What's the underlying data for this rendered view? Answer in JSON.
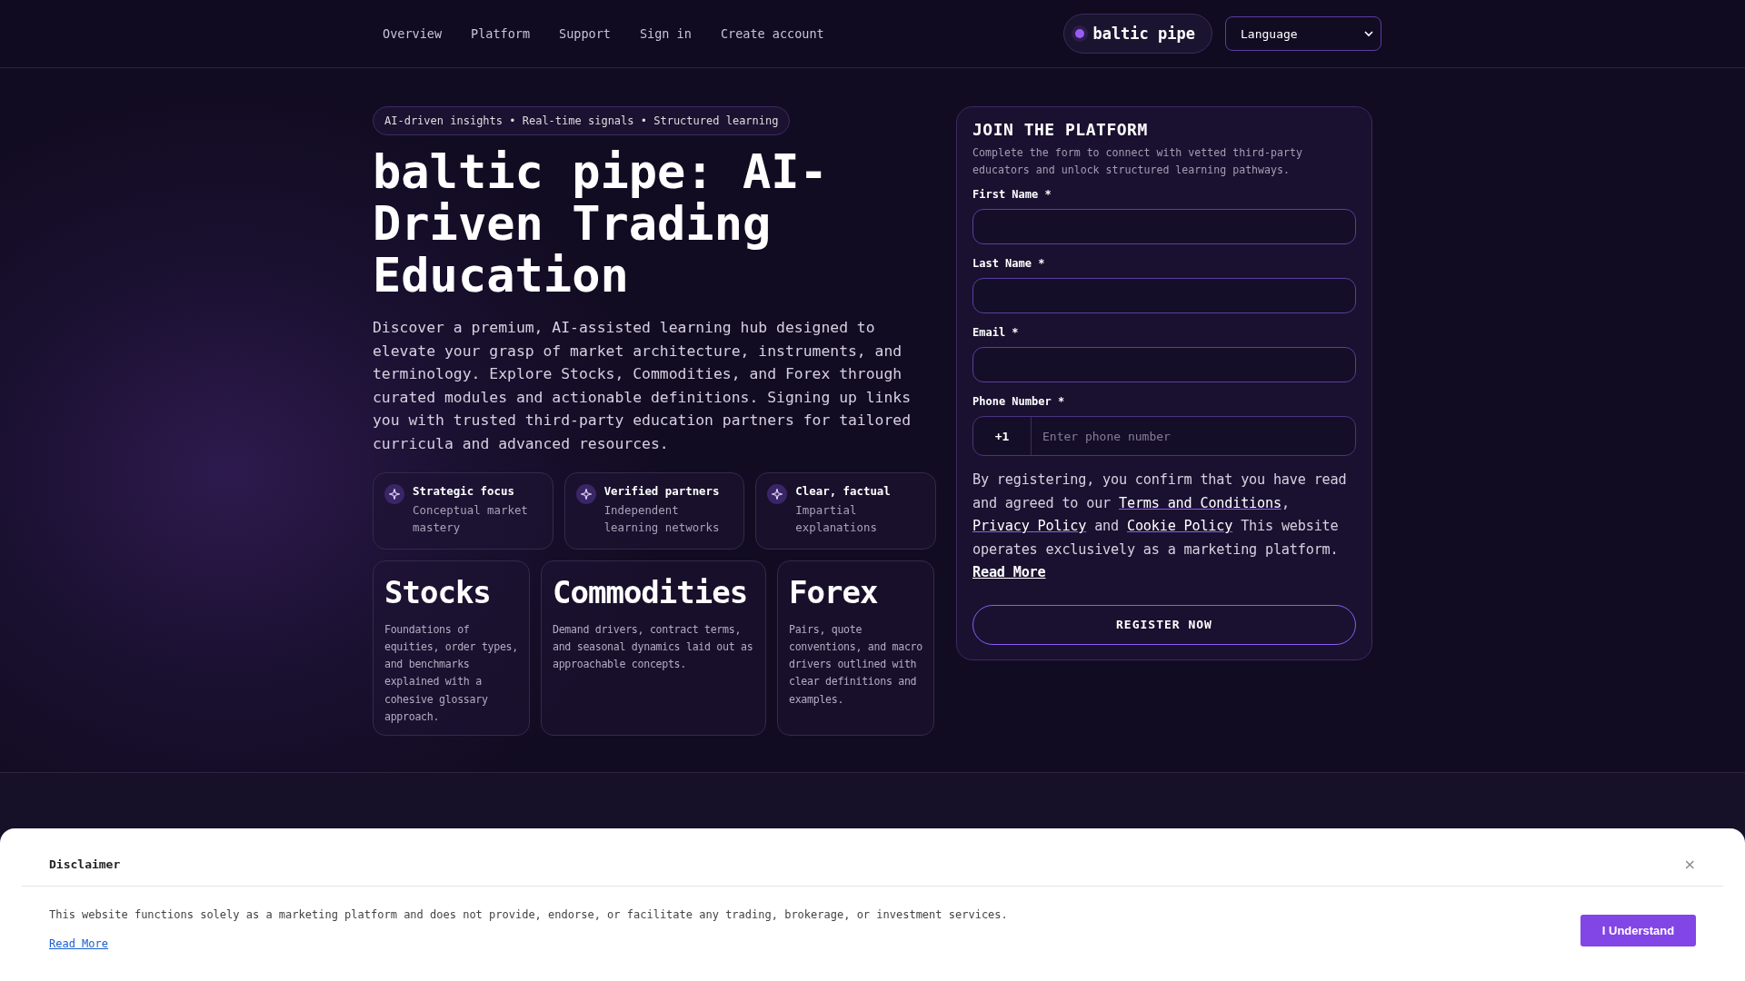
{
  "nav": {
    "links": [
      "Overview",
      "Platform",
      "Support",
      "Sign in",
      "Create account"
    ],
    "brand": "baltic pipe",
    "language": "Language"
  },
  "hero": {
    "tagline": "AI-driven insights • Real-time signals • Structured learning",
    "title": "baltic pipe: AI-Driven Trading Education",
    "description": "Discover a premium, AI-assisted learning hub designed to elevate your grasp of market architecture, instruments, and terminology. Explore Stocks, Commodities, and Forex through curated modules and actionable definitions. Signing up links you with trusted third-party education partners for tailored curricula and advanced resources.",
    "features": [
      {
        "title": "Strategic focus",
        "text": "Conceptual market mastery"
      },
      {
        "title": "Verified partners",
        "text": "Independent learning networks"
      },
      {
        "title": "Clear, factual",
        "text": "Impartial explanations"
      }
    ],
    "topics": [
      {
        "title": "Stocks",
        "text": "Foundations of equities, order types, and benchmarks explained with a cohesive glossary approach."
      },
      {
        "title": "Commodities",
        "text": "Demand drivers, contract terms, and seasonal dynamics laid out as approachable concepts."
      },
      {
        "title": "Forex",
        "text": "Pairs, quote conventions, and macro drivers outlined with clear definitions and examples."
      }
    ]
  },
  "form": {
    "title": "JOIN THE PLATFORM",
    "subtitle": "Complete the form to connect with vetted third-party educators and unlock structured learning pathways.",
    "fields": [
      {
        "kind": "text",
        "label": "First Name *"
      },
      {
        "kind": "text",
        "label": "Last Name *"
      },
      {
        "kind": "text",
        "label": "Email *"
      },
      {
        "kind": "phone",
        "label": "Phone Number *",
        "prefix": "+1",
        "placeholder": "Enter phone number"
      }
    ],
    "consent": [
      {
        "kind": "text",
        "text": "By registering, you confirm that you have read and agreed to our "
      },
      {
        "kind": "link",
        "text": "Terms and Conditions"
      },
      {
        "kind": "text",
        "text": ", "
      },
      {
        "kind": "link",
        "text": "Privacy Policy"
      },
      {
        "kind": "text",
        "text": " and "
      },
      {
        "kind": "link",
        "text": "Cookie Policy"
      },
      {
        "kind": "text",
        "text": " This website operates exclusively as a marketing platform. "
      },
      {
        "kind": "strong-link",
        "text": "Read More"
      }
    ],
    "submit": "REGISTER NOW"
  },
  "disclaimer": {
    "title": "Disclaimer",
    "close": "×",
    "text": "This website functions solely as a marketing platform and does not provide, endorse, or facilitate any trading, brokerage, or investment services.",
    "link": "Read More",
    "button": "I Understand"
  }
}
